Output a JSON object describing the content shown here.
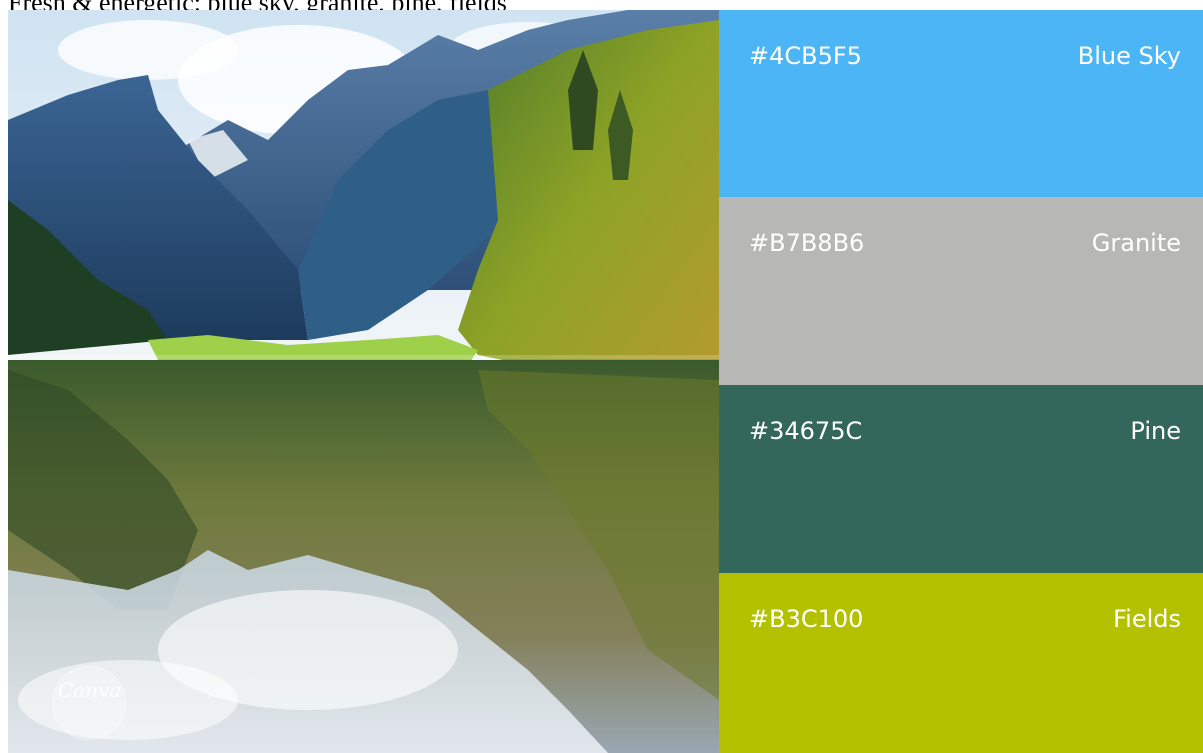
{
  "caption": "Fresh & energetic: blue sky, granite, pine, fields",
  "logo_text": "Canva",
  "swatches": [
    {
      "hex": "#4CB5F5",
      "name": "Blue Sky",
      "color": "#4CB5F5"
    },
    {
      "hex": "#B7B8B6",
      "name": "Granite",
      "color": "#B7B8B6"
    },
    {
      "hex": "#34675C",
      "name": "Pine",
      "color": "#34675C"
    },
    {
      "hex": "#B3C100",
      "name": "Fields",
      "color": "#B3C100"
    }
  ]
}
